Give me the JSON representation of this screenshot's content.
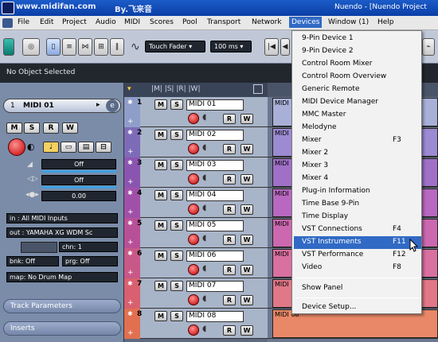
{
  "titlebar": {
    "watermark": "www.midifan.com",
    "watermark_author": "By.飞来音",
    "window_title": "Nuendo - [Nuendo Project"
  },
  "menubar": {
    "items": [
      "File",
      "Edit",
      "Project",
      "Audio",
      "MIDI",
      "Scores",
      "Pool",
      "Transport",
      "Network",
      "Devices",
      "Window (1)",
      "Help"
    ],
    "active": "Devices"
  },
  "toolbar": {
    "automation_mode": "Touch Fader",
    "latency": "100 ms"
  },
  "info_line": {
    "status": "No Object Selected"
  },
  "inspector": {
    "track_name": "MIDI 01",
    "button_labels": [
      "M",
      "S",
      "R",
      "W"
    ],
    "volume": "Off",
    "pan": "Off",
    "delay": "0.00",
    "input": "in : All MIDI Inputs",
    "output": "out : YAMAHA XG WDM Sc",
    "channel": "chn: 1",
    "bank": "bnk: Off",
    "program": "prg: Off",
    "map": "map: No Drum Map",
    "sections": [
      "Track Parameters",
      "Inserts"
    ]
  },
  "track_header": {
    "labels": "|M| |S| |R| |W|"
  },
  "tracks": [
    {
      "num": "1",
      "name": "MIDI 01",
      "color": "#8f9ec8",
      "lane_color": "#a8b0d8"
    },
    {
      "num": "2",
      "name": "MIDI 02",
      "color": "#7d6bb8",
      "lane_color": "#9c8ad2"
    },
    {
      "num": "3",
      "name": "MIDI 03",
      "color": "#8a55b0",
      "lane_color": "#a070c8"
    },
    {
      "num": "4",
      "name": "MIDI 04",
      "color": "#a050a8",
      "lane_color": "#b868c0"
    },
    {
      "num": "5",
      "name": "MIDI 05",
      "color": "#b85098",
      "lane_color": "#cc68b0"
    },
    {
      "num": "6",
      "name": "MIDI 06",
      "color": "#c85888",
      "lane_color": "#d870a0"
    },
    {
      "num": "7",
      "name": "MIDI 07",
      "color": "#d86070",
      "lane_color": "#e07888"
    },
    {
      "num": "8",
      "name": "MIDI 08",
      "color": "#e07050",
      "lane_color": "#e88868"
    }
  ],
  "track_buttons": {
    "m": "M",
    "s": "S",
    "r": "R",
    "w": "W"
  },
  "devices_menu": {
    "items": [
      {
        "label": "9-Pin Device 1",
        "shortcut": ""
      },
      {
        "label": "9-Pin Device 2",
        "shortcut": ""
      },
      {
        "label": "Control Room Mixer",
        "shortcut": ""
      },
      {
        "label": "Control Room Overview",
        "shortcut": ""
      },
      {
        "label": "Generic Remote",
        "shortcut": ""
      },
      {
        "label": "MIDI Device Manager",
        "shortcut": ""
      },
      {
        "label": "MMC Master",
        "shortcut": ""
      },
      {
        "label": "Melodyne",
        "shortcut": ""
      },
      {
        "label": "Mixer",
        "shortcut": "F3"
      },
      {
        "label": "Mixer 2",
        "shortcut": ""
      },
      {
        "label": "Mixer 3",
        "shortcut": ""
      },
      {
        "label": "Mixer 4",
        "shortcut": ""
      },
      {
        "label": "Plug-in Information",
        "shortcut": ""
      },
      {
        "label": "Time Base 9-Pin",
        "shortcut": ""
      },
      {
        "label": "Time Display",
        "shortcut": ""
      },
      {
        "label": "VST Connections",
        "shortcut": "F4"
      },
      {
        "label": "VST Instruments",
        "shortcut": "F11"
      },
      {
        "label": "VST Performance",
        "shortcut": "F12"
      },
      {
        "label": "Video",
        "shortcut": "F8"
      }
    ],
    "highlighted": "VST Instruments",
    "footer_items": [
      {
        "label": "Show Panel",
        "shortcut": ""
      },
      {
        "label": "Device Setup...",
        "shortcut": ""
      }
    ]
  },
  "colors": {
    "title_blue": "#0a3ea6",
    "menu_highlight": "#316ac5",
    "inspector_bg": "#7a8ca8"
  }
}
